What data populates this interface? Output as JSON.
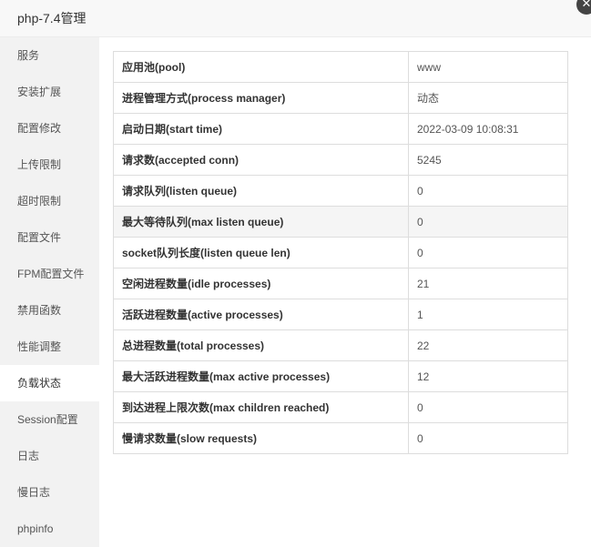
{
  "window": {
    "title": "php-7.4管理",
    "close_glyph": "✕"
  },
  "sidebar": {
    "active_index": 10,
    "items": [
      {
        "label": "服务"
      },
      {
        "label": "安装扩展"
      },
      {
        "label": "配置修改"
      },
      {
        "label": "上传限制"
      },
      {
        "label": "超时限制"
      },
      {
        "label": "配置文件"
      },
      {
        "label": "FPM配置文件"
      },
      {
        "label": "禁用函数"
      },
      {
        "label": "性能调整"
      },
      {
        "label": "负载状态"
      },
      {
        "label": "Session配置"
      },
      {
        "label": "日志"
      },
      {
        "label": "慢日志"
      },
      {
        "label": "phpinfo"
      }
    ]
  },
  "status": {
    "rows": [
      {
        "key": "应用池(pool)",
        "value": "www"
      },
      {
        "key": "进程管理方式(process manager)",
        "value": "动态"
      },
      {
        "key": "启动日期(start time)",
        "value": "2022-03-09 10:08:31"
      },
      {
        "key": "请求数(accepted conn)",
        "value": "5245"
      },
      {
        "key": "请求队列(listen queue)",
        "value": "0"
      },
      {
        "key": "最大等待队列(max listen queue)",
        "value": "0"
      },
      {
        "key": "socket队列长度(listen queue len)",
        "value": "0"
      },
      {
        "key": "空闲进程数量(idle processes)",
        "value": "21"
      },
      {
        "key": "活跃进程数量(active processes)",
        "value": "1"
      },
      {
        "key": "总进程数量(total processes)",
        "value": "22"
      },
      {
        "key": "最大活跃进程数量(max active processes)",
        "value": "12"
      },
      {
        "key": "到达进程上限次数(max children reached)",
        "value": "0"
      },
      {
        "key": "慢请求数量(slow requests)",
        "value": "0"
      }
    ]
  }
}
